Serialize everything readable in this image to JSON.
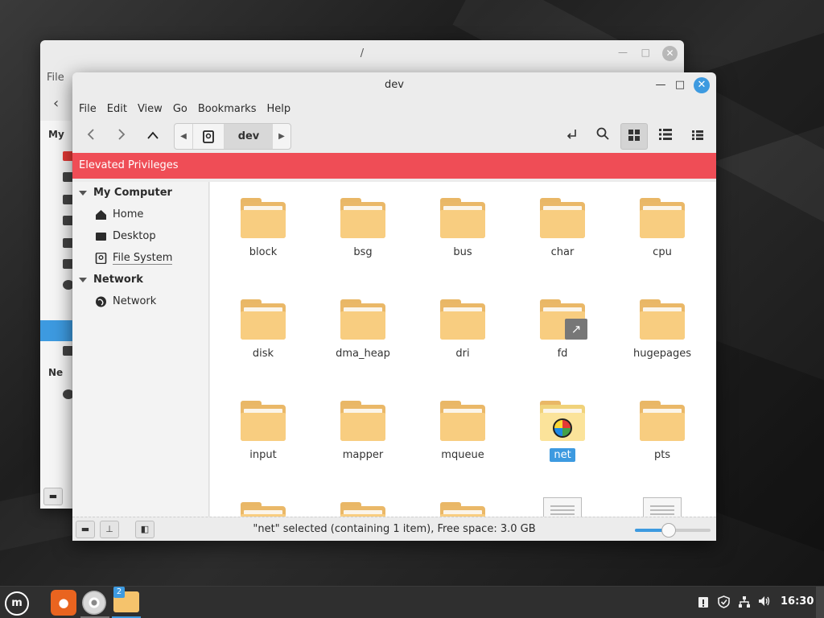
{
  "back_window": {
    "title": "/",
    "menu_first": "File",
    "side_headers": [
      "My",
      "Ne"
    ]
  },
  "window": {
    "title": "dev",
    "controls": {
      "minimize": "—",
      "maximize": "□",
      "close": "✕"
    }
  },
  "menu": [
    "File",
    "Edit",
    "View",
    "Go",
    "Bookmarks",
    "Help"
  ],
  "toolbar": {
    "back_icon": "chevron-left-icon",
    "forward_icon": "chevron-right-icon",
    "up_icon": "chevron-up-icon",
    "path_current": "dev",
    "view_modes": [
      "icon-view",
      "list-view",
      "compact-view"
    ],
    "active_view": "icon-view"
  },
  "banner": {
    "text": "Elevated Privileges",
    "color": "#ef4d56"
  },
  "sidebar": {
    "my_computer": "My Computer",
    "items": [
      {
        "label": "Home",
        "icon": "home-icon"
      },
      {
        "label": "Desktop",
        "icon": "desktop-icon"
      },
      {
        "label": "File System",
        "icon": "drive-icon"
      }
    ],
    "network_header": "Network",
    "network_items": [
      {
        "label": "Network",
        "icon": "globe-icon"
      }
    ]
  },
  "files": [
    {
      "name": "block",
      "type": "folder"
    },
    {
      "name": "bsg",
      "type": "folder"
    },
    {
      "name": "bus",
      "type": "folder"
    },
    {
      "name": "char",
      "type": "folder"
    },
    {
      "name": "cpu",
      "type": "folder"
    },
    {
      "name": "disk",
      "type": "folder"
    },
    {
      "name": "dma_heap",
      "type": "folder"
    },
    {
      "name": "dri",
      "type": "folder"
    },
    {
      "name": "fd",
      "type": "folder-link"
    },
    {
      "name": "hugepages",
      "type": "folder"
    },
    {
      "name": "input",
      "type": "folder"
    },
    {
      "name": "mapper",
      "type": "folder"
    },
    {
      "name": "mqueue",
      "type": "folder"
    },
    {
      "name": "net",
      "type": "folder-network",
      "selected": true
    },
    {
      "name": "pts",
      "type": "folder"
    }
  ],
  "partial_row": [
    "folder",
    "folder",
    "folder",
    "file",
    "file"
  ],
  "status": {
    "text": "\"net\" selected (containing 1 item), Free space: 3.0 GB",
    "zoom_fraction": 0.45
  },
  "taskbar": {
    "menu_icon": "mint-logo-icon",
    "apps": [
      "firefox-icon",
      "disc-icon",
      "files-icon"
    ],
    "files_badge": "2",
    "tray": [
      "clipboard-icon",
      "shield-icon",
      "network-icon",
      "volume-icon"
    ],
    "clock": "16:30"
  },
  "colors": {
    "accent": "#3d9ae0",
    "folder": "#f8cd80"
  }
}
